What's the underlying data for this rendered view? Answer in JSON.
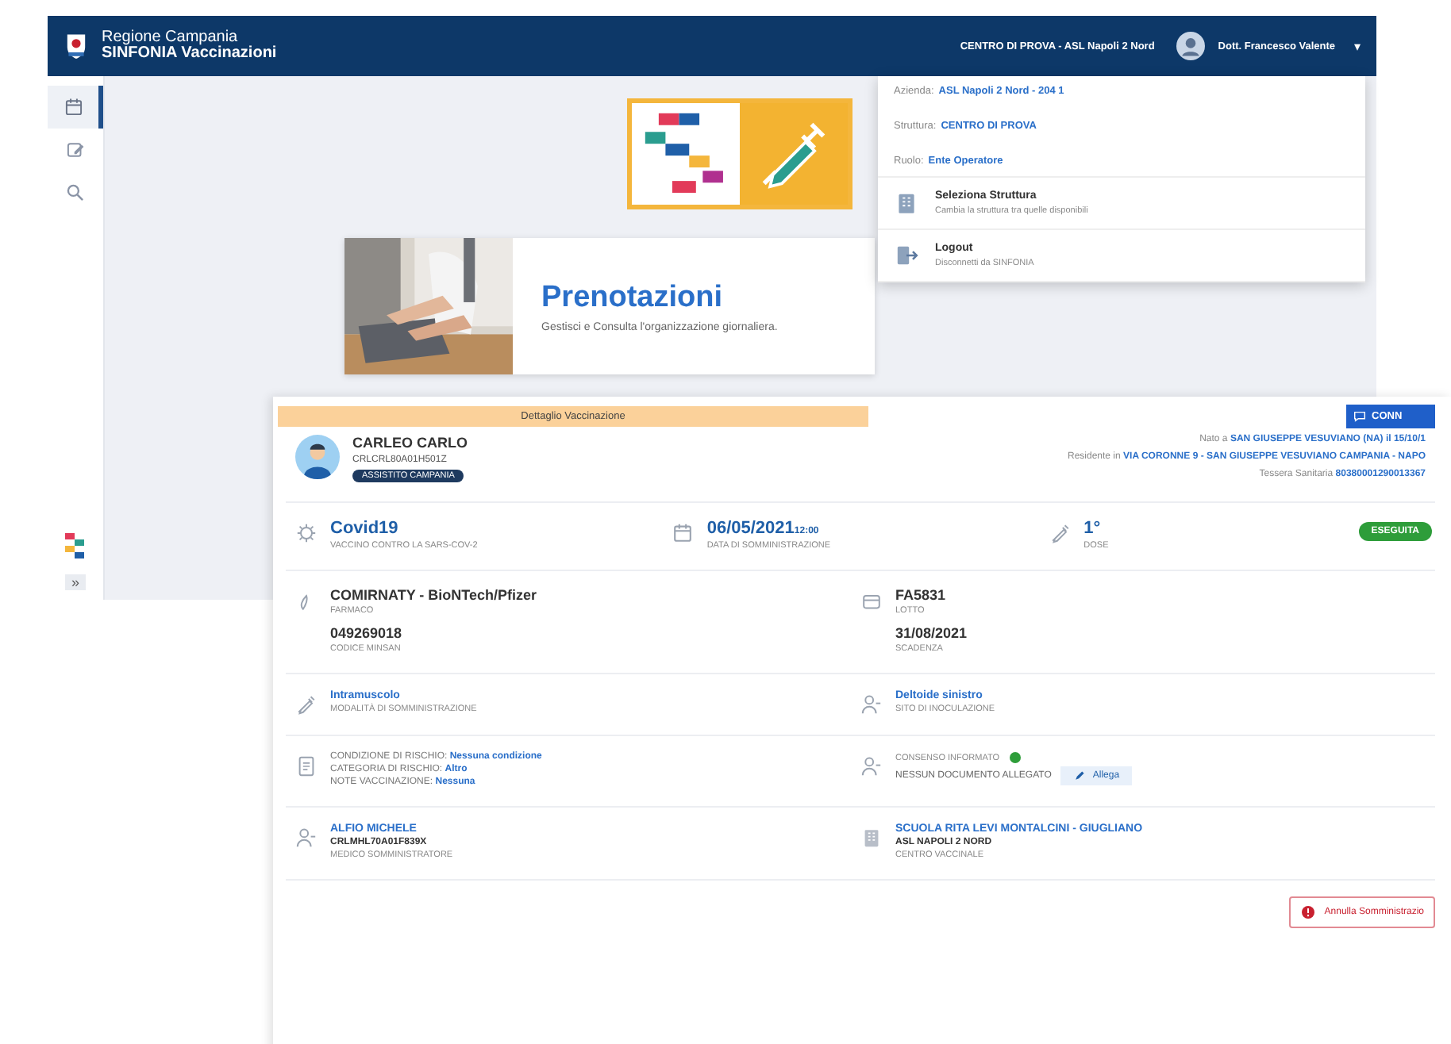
{
  "header": {
    "region": "Regione Campania",
    "app": "SINFONIA Vaccinazioni",
    "context": "CENTRO DI PROVA - ASL Napoli 2 Nord",
    "user": "Dott. Francesco Valente",
    "caret": "▾"
  },
  "sidebar": {
    "items": [
      {
        "kind": "calendar",
        "selected": true
      },
      {
        "kind": "edit",
        "selected": false
      },
      {
        "kind": "search",
        "selected": false
      }
    ],
    "toggle": "»"
  },
  "user_menu": {
    "info": [
      {
        "label": "Azienda:",
        "value": "ASL Napoli 2 Nord - 204 1"
      },
      {
        "label": "Struttura:",
        "value": "CENTRO DI PROVA"
      },
      {
        "label": "Ruolo:",
        "value": "Ente Operatore"
      }
    ],
    "actions": [
      {
        "kind": "building",
        "title": "Seleziona Struttura",
        "subtitle": "Cambia la struttura tra quelle disponibili"
      },
      {
        "kind": "logout",
        "title": "Logout",
        "subtitle": "Disconnetti da SINFONIA"
      }
    ]
  },
  "prenotazioni": {
    "title": "Prenotazioni",
    "subtitle": "Gestisci e Consulta l'organizzazione giornaliera."
  },
  "detail": {
    "banner": "Dettaglio Vaccinazione",
    "top_button": "CONN",
    "patient": {
      "name": "CARLEO CARLO",
      "code": "CRLCRL80A01H501Z",
      "badge": "ASSISTITO CAMPANIA",
      "info": [
        {
          "label": "Nato a",
          "value": "SAN GIUSEPPE VESUVIANO (NA) il 15/10/1"
        },
        {
          "label": "Residente in",
          "value": "VIA CORONNE 9 - SAN GIUSEPPE VESUVIANO CAMPANIA - NAPO"
        },
        {
          "label": "Tessera Sanitaria",
          "value": "80380001290013367"
        }
      ]
    },
    "status": "ESEGUITA",
    "sections": [
      {
        "columns": [
          {
            "kind": "virus",
            "lines": [
              {
                "kind": "value",
                "text": "Covid19"
              },
              {
                "kind": "label",
                "text": "VACCINO CONTRO LA SARS-COV-2"
              }
            ]
          },
          {
            "kind": "calendar",
            "lines": [
              {
                "kind": "value",
                "text": "06/05/2021",
                "extra": "12:00"
              },
              {
                "kind": "label",
                "text": "DATA DI SOMMINISTRAZIONE"
              }
            ]
          },
          {
            "kind": "syringe",
            "lines": [
              {
                "kind": "value",
                "text": "1°"
              },
              {
                "kind": "label",
                "text": "DOSE"
              }
            ]
          }
        ]
      },
      {
        "columns": [
          {
            "kind": "pill",
            "lines": [
              {
                "kind": "dark",
                "text": "COMIRNATY - BioNTech/Pfizer"
              },
              {
                "kind": "label",
                "text": "FARMACO"
              },
              {
                "kind": "dark",
                "text": "049269018"
              },
              {
                "kind": "label",
                "text": "CODICE MINSAN"
              }
            ]
          },
          {
            "kind": "box",
            "lines": [
              {
                "kind": "dark",
                "text": "FA5831"
              },
              {
                "kind": "label",
                "text": "LOTTO"
              },
              {
                "kind": "dark",
                "text": "31/08/2021"
              },
              {
                "kind": "label",
                "text": "SCADENZA"
              }
            ]
          }
        ]
      },
      {
        "columns": [
          {
            "kind": "syringe",
            "lines": [
              {
                "kind": "link",
                "text": "Intramuscolo"
              },
              {
                "kind": "label",
                "text": "MODALITÀ DI SOMMINISTRAZIONE"
              }
            ]
          },
          {
            "kind": "person",
            "lines": [
              {
                "kind": "link",
                "text": "Deltoide sinistro"
              },
              {
                "kind": "label",
                "text": "SITO DI INOCULAZIONE"
              }
            ]
          }
        ]
      },
      {
        "columns": [
          {
            "kind": "doc",
            "lines": [
              {
                "kind": "pair",
                "text": "CONDIZIONE DI RISCHIO:",
                "extra": "Nessuna condizione"
              },
              {
                "kind": "pair",
                "text": "CATEGORIA DI RISCHIO:",
                "extra": "Altro"
              },
              {
                "kind": "pair",
                "text": "NOTE VACCINAZIONE:",
                "extra": "Nessuna"
              }
            ]
          },
          {
            "kind": "person",
            "lines": [
              {
                "kind": "dot",
                "text": "CONSENSO INFORMATO",
                "color": "#2e9d3a"
              },
              {
                "kind": "attach",
                "text": "NESSUN DOCUMENTO ALLEGATO",
                "extra": "Allega"
              }
            ]
          }
        ]
      },
      {
        "columns": [
          {
            "kind": "person",
            "lines": [
              {
                "kind": "link",
                "text": "ALFIO MICHELE"
              },
              {
                "kind": "bold",
                "text": "CRLMHL70A01F839X"
              },
              {
                "kind": "label",
                "text": "MEDICO SOMMINISTRATORE"
              }
            ]
          },
          {
            "kind": "building",
            "lines": [
              {
                "kind": "link",
                "text": "SCUOLA RITA LEVI MONTALCINI - GIUGLIANO"
              },
              {
                "kind": "bold",
                "text": "ASL NAPOLI 2 NORD"
              },
              {
                "kind": "label",
                "text": "CENTRO VACCINALE"
              }
            ]
          }
        ]
      }
    ],
    "cancel_button": "Annulla Somministrazio"
  }
}
